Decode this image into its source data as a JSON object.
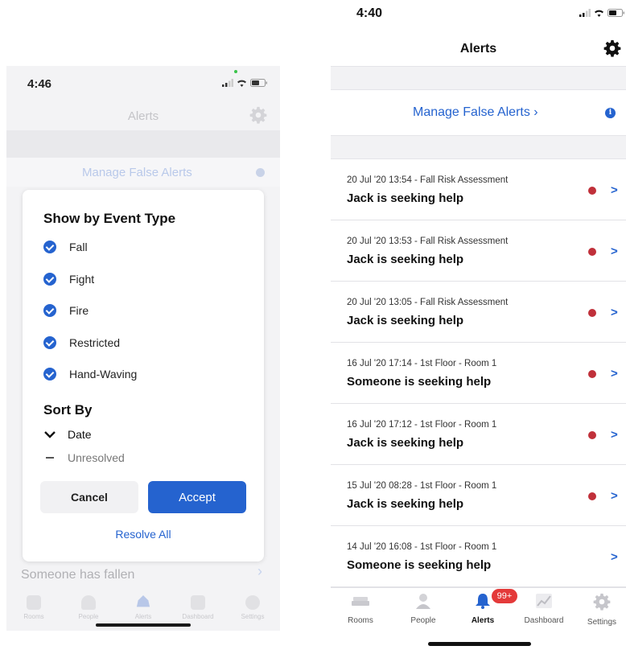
{
  "left_screen": {
    "status_bar": {
      "time": "4:46"
    },
    "nav": {
      "title": "Alerts",
      "settings_icon": "gear-icon"
    },
    "manage_false_alerts": "Manage False Alerts",
    "background_alert_message": "Someone has fallen",
    "filter_modal": {
      "title": "Show by Event Type",
      "event_types": [
        {
          "label": "Fall",
          "checked": true
        },
        {
          "label": "Fight",
          "checked": true
        },
        {
          "label": "Fire",
          "checked": true
        },
        {
          "label": "Restricted",
          "checked": true
        },
        {
          "label": "Hand-Waving",
          "checked": true
        }
      ],
      "sort_title": "Sort By",
      "sort_options": [
        {
          "label": "Date",
          "state": "chevron-down"
        },
        {
          "label": "Unresolved",
          "state": "dash"
        }
      ],
      "cancel_label": "Cancel",
      "accept_label": "Accept",
      "resolve_all_label": "Resolve All"
    },
    "tabs": [
      {
        "label": "Rooms",
        "icon": "bed-icon"
      },
      {
        "label": "People",
        "icon": "person-icon"
      },
      {
        "label": "Alerts",
        "icon": "bell-icon",
        "active": true
      },
      {
        "label": "Dashboard",
        "icon": "chart-icon"
      },
      {
        "label": "Settings",
        "icon": "gear-icon"
      }
    ]
  },
  "right_screen": {
    "status_bar": {
      "time": "4:40"
    },
    "nav": {
      "title": "Alerts",
      "settings_icon": "gear-icon"
    },
    "manage_false_alerts": "Manage False Alerts ›",
    "alerts": [
      {
        "meta": "20 Jul '20 13:54 - Fall Risk Assessment",
        "message": "Jack is seeking help",
        "unresolved": true
      },
      {
        "meta": "20 Jul '20 13:53 - Fall Risk Assessment",
        "message": "Jack is seeking help",
        "unresolved": true
      },
      {
        "meta": "20 Jul '20 13:05 - Fall Risk Assessment",
        "message": "Jack is seeking help",
        "unresolved": true
      },
      {
        "meta": "16 Jul '20 17:14 - 1st Floor - Room 1",
        "message": "Someone is seeking help",
        "unresolved": true
      },
      {
        "meta": "16 Jul '20 17:12 - 1st Floor - Room 1",
        "message": "Jack is seeking help",
        "unresolved": true
      },
      {
        "meta": "15 Jul '20 08:28 - 1st Floor - Room 1",
        "message": "Jack is seeking help",
        "unresolved": true
      },
      {
        "meta": "14 Jul '20 16:08 - 1st Floor - Room 1",
        "message": "Someone is seeking help",
        "unresolved": false
      }
    ],
    "alerts_badge": "99+",
    "tabs": [
      {
        "label": "Rooms",
        "icon": "bed-icon"
      },
      {
        "label": "People",
        "icon": "person-icon"
      },
      {
        "label": "Alerts",
        "icon": "bell-icon",
        "active": true
      },
      {
        "label": "Dashboard",
        "icon": "chart-icon"
      },
      {
        "label": "Settings",
        "icon": "gear-icon"
      }
    ]
  },
  "colors": {
    "accent": "#2563cf",
    "unresolved_dot": "#c0303a",
    "badge": "#e43a3a"
  }
}
